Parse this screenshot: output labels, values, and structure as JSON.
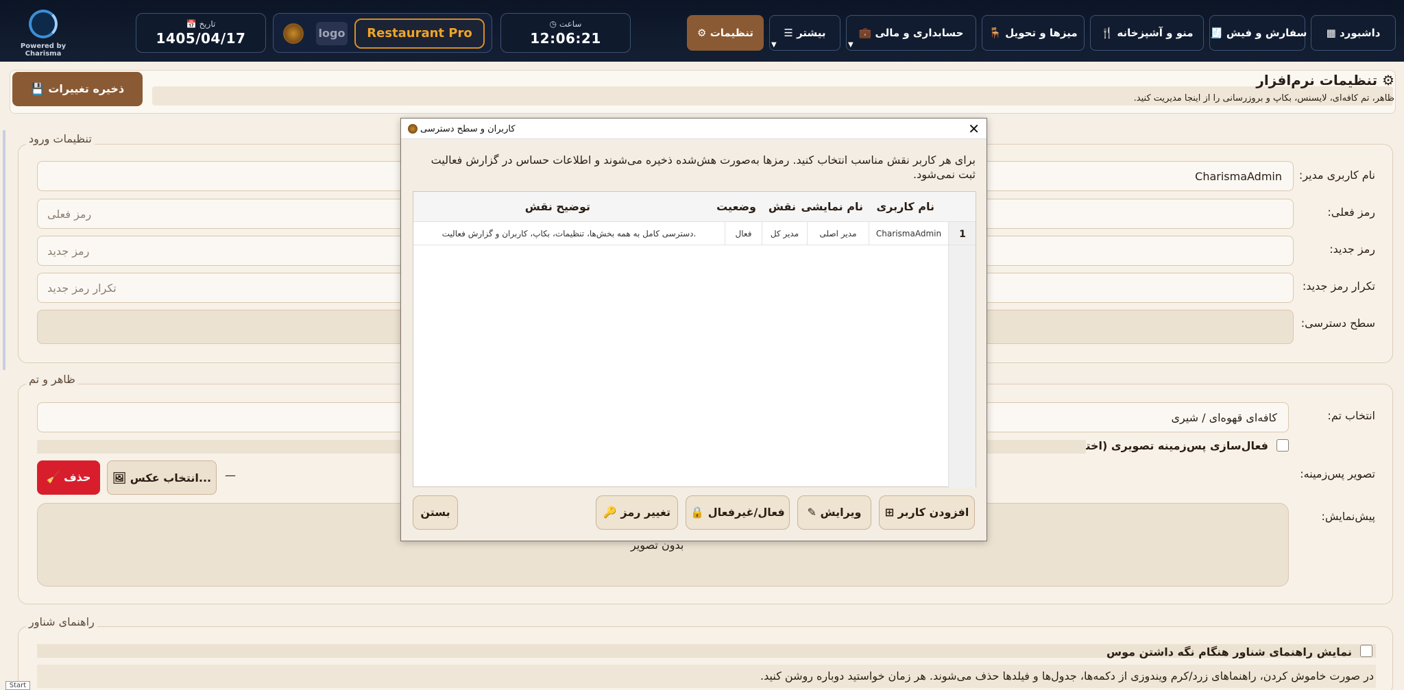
{
  "topbar": {
    "powered_by": "Powered by Charisma",
    "date_label": "تاریخ",
    "date_value": "1405/04/17",
    "logo_text": "logo",
    "product_name": "Restaurant Pro",
    "time_label": "ساعت",
    "time_value": "12:06:21",
    "nav": [
      {
        "label": "تنظیمات",
        "icon": "gear-icon"
      },
      {
        "label": "بیشتر",
        "icon": "menu-icon"
      },
      {
        "label": "حسابداری و مالی",
        "icon": "briefcase-icon"
      },
      {
        "label": "میزها و تحویل",
        "icon": "table-icon"
      },
      {
        "label": "منو و آشپزخانه",
        "icon": "cutlery-icon"
      },
      {
        "label": "سفارش و فیش",
        "icon": "receipt-icon"
      },
      {
        "label": "داشبورد",
        "icon": "dashboard-icon"
      }
    ]
  },
  "header": {
    "save_label": "ذخیره تغییرات",
    "title": "تنظیمات نرم‌افزار",
    "subtitle": "ظاهر، تم کافه‌ای، لایسنس، بکاپ و بروزرسانی را از اینجا مدیریت کنید."
  },
  "login_settings": {
    "title": "تنظیمات ورود",
    "admin_username_label": "نام کاربری مدیر:",
    "admin_username_value": "CharismaAdmin",
    "current_password_label": "رمز فعلی:",
    "current_password_placeholder": "رمز فعلی",
    "new_password_label": "رمز جدید:",
    "new_password_placeholder": "رمز جدید",
    "repeat_password_label": "تکرار رمز جدید:",
    "repeat_password_placeholder": "تکرار رمز جدید",
    "access_level_label": "سطح دسترسی:"
  },
  "theme": {
    "title": "ظاهر و تم",
    "theme_label": "انتخاب تم:",
    "theme_value": "کافه‌ای قهوه‌ای / شیری",
    "bg_checkbox_label": "فعال‌سازی پس‌زمینه تصویری (اختیاری)",
    "bg_image_label": "تصویر پس‌زمینه:",
    "bg_image_value": "—",
    "pick_button": "انتخاب عکس...",
    "delete_button": "حذف",
    "preview_label": "پیش‌نمایش:",
    "preview_text": "بدون تصویر"
  },
  "tooltip": {
    "title": "راهنمای شناور",
    "checkbox_label": "نمایش راهنمای شناور هنگام نگه داشتن موس",
    "description": "در صورت خاموش کردن، راهنماهای زرد/کرم ویندوزی از دکمه‌ها، جدول‌ها و فیلدها حذف می‌شوند. هر زمان خواستید دوباره روشن کنید."
  },
  "dialog": {
    "title": "کاربران و سطح دسترسی",
    "description": "برای هر کاربر نقش مناسب انتخاب کنید. رمزها به‌صورت هش‌شده ذخیره می‌شوند و اطلاعات حساس در گزارش فعالیت ثبت نمی‌شود.",
    "columns": [
      "نام کاربری",
      "نام نمایشی",
      "نقش",
      "وضعیت",
      "توضیح نقش"
    ],
    "rows": [
      {
        "index": "1",
        "username": "CharismaAdmin",
        "display_name": "مدیر اصلی",
        "role": "مدیر کل",
        "status": "فعال",
        "role_desc": "دسترسی کامل به همه بخش‌ها، تنظیمات، بکاپ، کاربران و گزارش فعالیت."
      }
    ],
    "buttons": {
      "add_user": "افزودن کاربر",
      "edit": "ویرایش",
      "toggle_active": "فعال/غیرفعال",
      "change_password": "تغییر رمز",
      "close": "بستن"
    }
  },
  "taskbar": {
    "start": "Start"
  },
  "colors": {
    "accent": "#8a5a34",
    "danger": "#d81e2c",
    "topbar": "#0b1526",
    "gold": "#f0a428"
  }
}
